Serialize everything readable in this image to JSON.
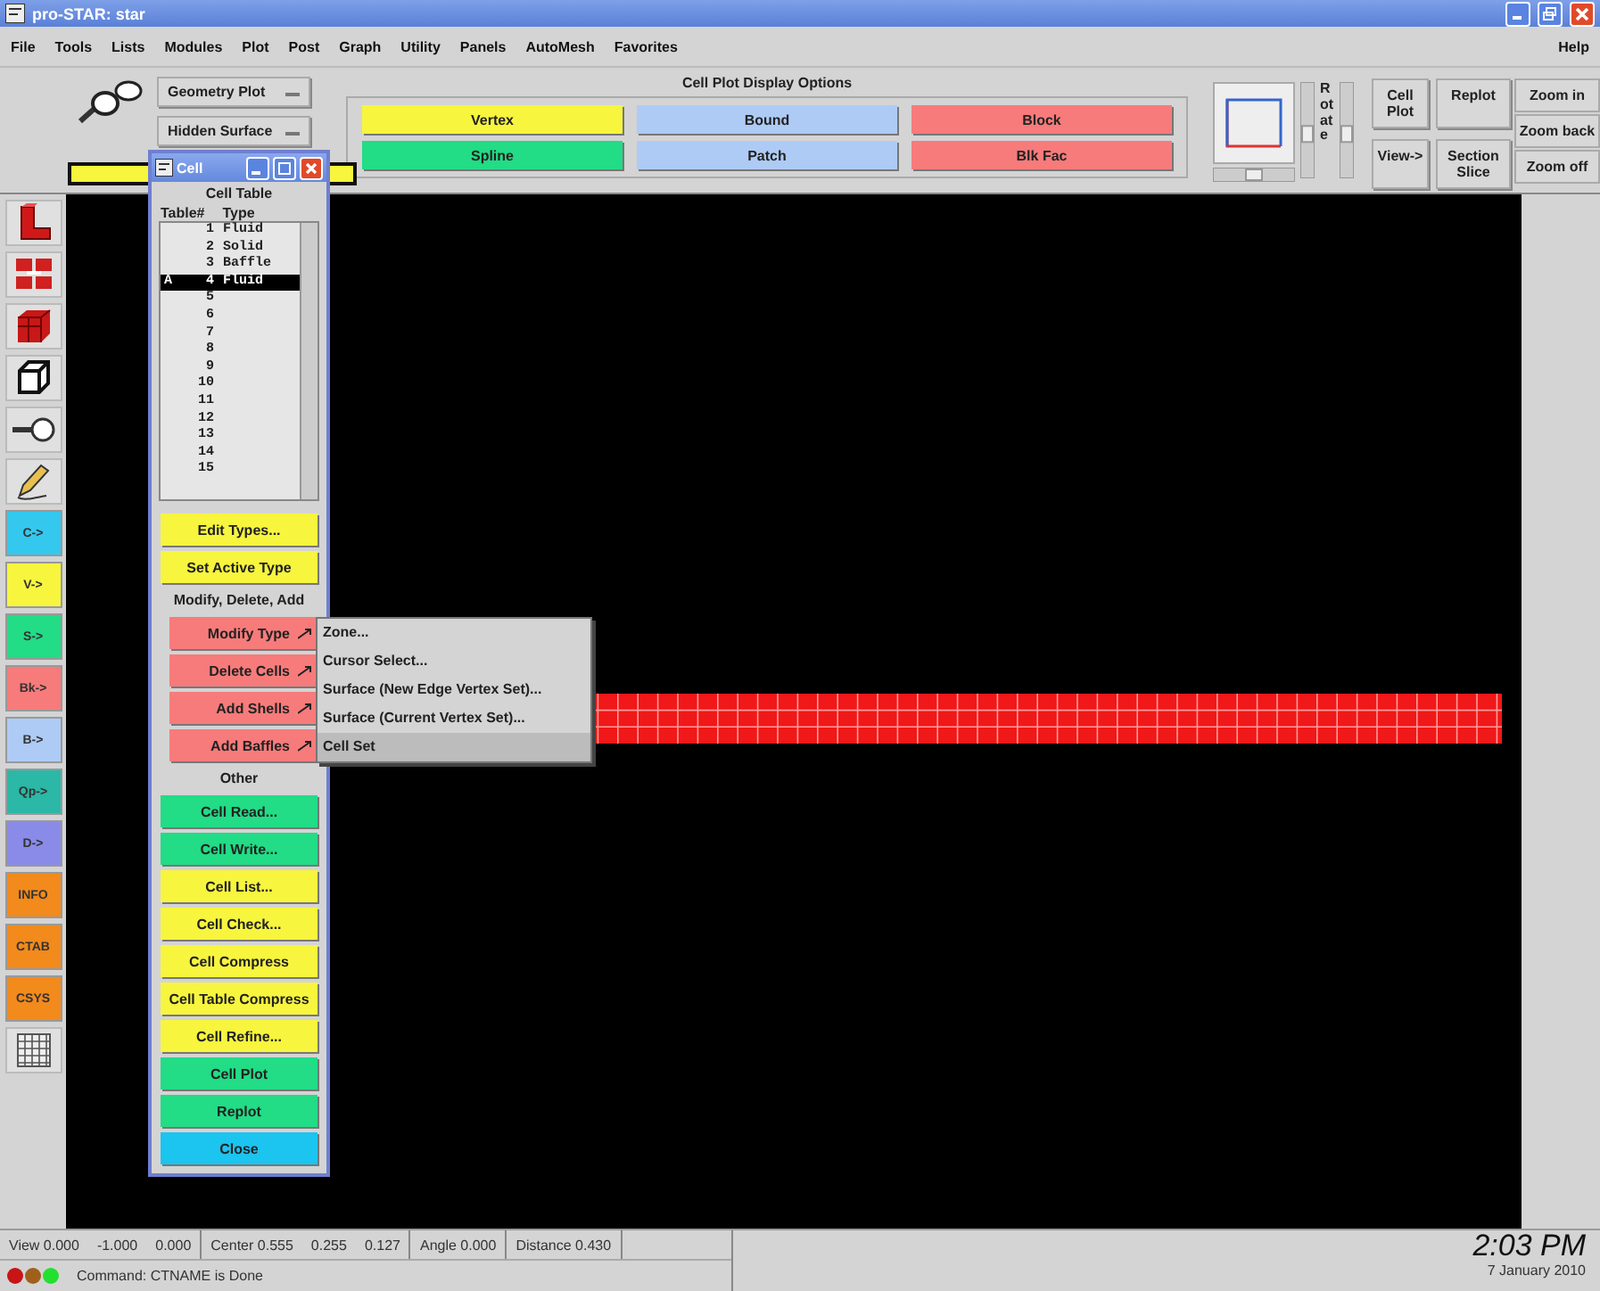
{
  "window": {
    "title": "pro-STAR: star"
  },
  "menu": [
    "File",
    "Tools",
    "Lists",
    "Modules",
    "Plot",
    "Post",
    "Graph",
    "Utility",
    "Panels",
    "AutoMesh",
    "Favorites"
  ],
  "help_menu": "Help",
  "plot_selectors": [
    {
      "value": "Geometry Plot"
    },
    {
      "value": "Hidden Surface"
    }
  ],
  "display_options": {
    "title": "Cell Plot Display Options",
    "buttons": [
      {
        "label": "Vertex",
        "color": "#f7f53e"
      },
      {
        "label": "Bound",
        "color": "#aecbf5"
      },
      {
        "label": "Block",
        "color": "#f77b7b"
      },
      {
        "label": "Spline",
        "color": "#22dc86"
      },
      {
        "label": "Patch",
        "color": "#aecbf5"
      },
      {
        "label": "Blk Fac",
        "color": "#f77b7b"
      }
    ]
  },
  "rotate_label": "Rotate",
  "view_sliders": [
    {
      "kind": "horizontal",
      "level": 0.5
    },
    {
      "kind": "vertical",
      "level": 0.45
    },
    {
      "kind": "vertical",
      "level": 0.45
    }
  ],
  "view_buttons": [
    {
      "label": "Cell Plot"
    },
    {
      "label": "Replot"
    },
    {
      "label": "View->"
    },
    {
      "label": "Section Slice"
    }
  ],
  "zoom_buttons": [
    {
      "label": "Zoom in"
    },
    {
      "label": "Zoom back"
    },
    {
      "label": "Zoom off"
    }
  ],
  "left_toolbar": [
    {
      "kind": "icon"
    },
    {
      "kind": "icon"
    },
    {
      "kind": "icon"
    },
    {
      "kind": "icon"
    },
    {
      "kind": "icon"
    },
    {
      "kind": "icon"
    },
    {
      "kind": "label",
      "label": "C->",
      "color": "#34c8ee"
    },
    {
      "kind": "label",
      "label": "V->",
      "color": "#f7f53e"
    },
    {
      "kind": "label",
      "label": "S->",
      "color": "#22dc86"
    },
    {
      "kind": "label",
      "label": "Bk->",
      "color": "#f77b7b"
    },
    {
      "kind": "label",
      "label": "B->",
      "color": "#aecbf5"
    },
    {
      "kind": "label",
      "label": "Qp->",
      "color": "#2bb8a6"
    },
    {
      "kind": "label",
      "label": "D->",
      "color": "#8a8ae8"
    },
    {
      "kind": "label",
      "label": "INFO",
      "color": "#f28a1c"
    },
    {
      "kind": "label",
      "label": "CTAB",
      "color": "#f28a1c"
    },
    {
      "kind": "label",
      "label": "CSYS",
      "color": "#f28a1c"
    },
    {
      "kind": "icon"
    }
  ],
  "cell_window": {
    "title": "Cell",
    "heading": "Cell Table",
    "columns": [
      "Table#",
      "Type"
    ],
    "rows": [
      {
        "marker": "",
        "number": "1",
        "type": "Fluid",
        "selected": false
      },
      {
        "marker": "",
        "number": "2",
        "type": "Solid",
        "selected": false
      },
      {
        "marker": "",
        "number": "3",
        "type": "Baffle",
        "selected": false
      },
      {
        "marker": "A",
        "number": "4",
        "type": "Fluid",
        "selected": true
      },
      {
        "marker": "",
        "number": "5",
        "type": "",
        "selected": false
      },
      {
        "marker": "",
        "number": "6",
        "type": "",
        "selected": false
      },
      {
        "marker": "",
        "number": "7",
        "type": "",
        "selected": false
      },
      {
        "marker": "",
        "number": "8",
        "type": "",
        "selected": false
      },
      {
        "marker": "",
        "number": "9",
        "type": "",
        "selected": false
      },
      {
        "marker": "",
        "number": "10",
        "type": "",
        "selected": false
      },
      {
        "marker": "",
        "number": "11",
        "type": "",
        "selected": false
      },
      {
        "marker": "",
        "number": "12",
        "type": "",
        "selected": false
      },
      {
        "marker": "",
        "number": "13",
        "type": "",
        "selected": false
      },
      {
        "marker": "",
        "number": "14",
        "type": "",
        "selected": false
      },
      {
        "marker": "",
        "number": "15",
        "type": "",
        "selected": false
      }
    ],
    "controls": [
      {
        "kind": "button",
        "label": "Edit Types...",
        "color": "#f7f53e"
      },
      {
        "kind": "button",
        "label": "Set Active Type",
        "color": "#f7f53e"
      },
      {
        "kind": "heading",
        "label": "Modify, Delete, Add"
      },
      {
        "kind": "cascade",
        "label": "Modify Type",
        "color": "#f77b7b"
      },
      {
        "kind": "cascade",
        "label": "Delete Cells",
        "color": "#f77b7b"
      },
      {
        "kind": "cascade",
        "label": "Add Shells",
        "color": "#f77b7b"
      },
      {
        "kind": "cascade",
        "label": "Add Baffles",
        "color": "#f77b7b"
      },
      {
        "kind": "heading",
        "label": "Other"
      },
      {
        "kind": "button",
        "label": "Cell Read...",
        "color": "#22dc86"
      },
      {
        "kind": "button",
        "label": "Cell Write...",
        "color": "#22dc86"
      },
      {
        "kind": "button",
        "label": "Cell List...",
        "color": "#f7f53e"
      },
      {
        "kind": "button",
        "label": "Cell Check...",
        "color": "#f7f53e"
      },
      {
        "kind": "button",
        "label": "Cell Compress",
        "color": "#f7f53e"
      },
      {
        "kind": "button",
        "label": "Cell Table Compress",
        "color": "#f7f53e"
      },
      {
        "kind": "button",
        "label": "Cell Refine...",
        "color": "#f7f53e"
      },
      {
        "kind": "button",
        "label": "Cell Plot",
        "color": "#22dc86"
      },
      {
        "kind": "button",
        "label": "Replot",
        "color": "#22dc86"
      },
      {
        "kind": "button",
        "label": "Close",
        "color": "#1cc4f0"
      }
    ]
  },
  "submenu": [
    {
      "label": "Zone...",
      "selected": false
    },
    {
      "label": "Cursor Select...",
      "selected": false
    },
    {
      "label": "Surface (New Edge Vertex Set)...",
      "selected": false
    },
    {
      "label": "Surface (Current Vertex Set)...",
      "selected": false
    },
    {
      "label": "Cell Set",
      "selected": true
    }
  ],
  "status_bar": {
    "view": [
      "View 0.000",
      "-1.000",
      "0.000"
    ],
    "center": [
      "Center 0.555",
      "0.255",
      "0.127"
    ],
    "angle": "Angle 0.000",
    "distance": "Distance 0.430",
    "lights": [
      {
        "color": "#c81414"
      },
      {
        "color": "#a0601c"
      },
      {
        "color": "#22e030"
      }
    ],
    "command": "Command: CTNAME is Done",
    "time": "2:03 PM",
    "date": "7 January 2010"
  }
}
